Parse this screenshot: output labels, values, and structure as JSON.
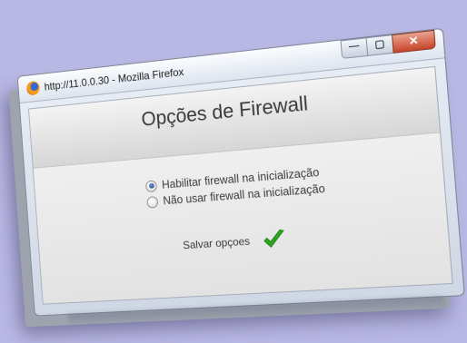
{
  "window": {
    "title": "http://11.0.0.30 - Mozilla Firefox",
    "buttons": {
      "minimize_glyph": "—",
      "maximize_glyph": "▢",
      "close_glyph": "✕"
    }
  },
  "page": {
    "heading": "Opções de Firewall",
    "options": [
      {
        "label": "Habilitar firewall na inicialização",
        "checked": true
      },
      {
        "label": "Não usar firewall na inicialização",
        "checked": false
      }
    ],
    "save_label": "Salvar opçoes",
    "save_icon": "checkmark-icon"
  },
  "colors": {
    "background": "#b9b7e3",
    "check_green": "#2fa51f",
    "close_red": "#c7442a"
  }
}
